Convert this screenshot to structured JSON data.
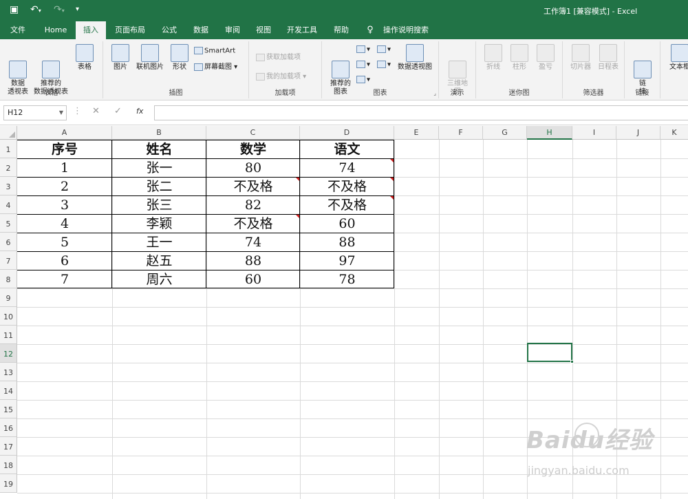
{
  "window": {
    "title": "工作簿1 [兼容模式] - Excel"
  },
  "tabs": [
    {
      "label": "文件"
    },
    {
      "label": "Home"
    },
    {
      "label": "插入",
      "active": true
    },
    {
      "label": "页面布局"
    },
    {
      "label": "公式"
    },
    {
      "label": "数据"
    },
    {
      "label": "审阅"
    },
    {
      "label": "视图"
    },
    {
      "label": "开发工具"
    },
    {
      "label": "帮助"
    },
    {
      "label": "操作说明搜索"
    }
  ],
  "ribbon": {
    "groups": {
      "tables": "表格",
      "illustrations": "插图",
      "addins": "加载项",
      "charts": "图表",
      "tours": "演示",
      "sparklines": "迷你图",
      "filters": "筛选器",
      "links": "链接"
    },
    "buttons": {
      "pivot_table": "数据\n透视表",
      "recommended_pivot": "推荐的\n数据透视表",
      "table": "表格",
      "pictures": "图片",
      "online_pictures": "联机图片",
      "shapes": "形状",
      "smartart": "SmartArt",
      "screenshot": "屏幕截图",
      "get_addins": "获取加载项",
      "my_addins": "我的加载项",
      "recommended_charts": "推荐的\n图表",
      "pivot_chart": "数据透视图",
      "map_3d": "三维地\n图",
      "spark_line": "折线",
      "spark_column": "柱形",
      "spark_winloss": "盈亏",
      "slicer": "切片器",
      "timeline": "日程表",
      "link": "链\n接",
      "textbox": "文本框"
    }
  },
  "formula_bar": {
    "name_box": "H12",
    "fx": "fx",
    "value": ""
  },
  "columns": [
    "A",
    "B",
    "C",
    "D",
    "E",
    "F",
    "G",
    "H",
    "I",
    "J",
    "K"
  ],
  "selected_column": "H",
  "rows": [
    "1",
    "2",
    "3",
    "4",
    "5",
    "6",
    "7",
    "8",
    "9",
    "10",
    "11",
    "12",
    "13",
    "14",
    "15",
    "16",
    "17",
    "18",
    "19"
  ],
  "selected_row": "12",
  "sheet": {
    "headers": [
      "序号",
      "姓名",
      "数学",
      "语文"
    ],
    "rows": [
      [
        "1",
        "张一",
        "80",
        "74"
      ],
      [
        "2",
        "张二",
        "不及格",
        "不及格"
      ],
      [
        "3",
        "张三",
        "82",
        "不及格"
      ],
      [
        "4",
        "李颖",
        "不及格",
        "60"
      ],
      [
        "5",
        "王一",
        "74",
        "88"
      ],
      [
        "6",
        "赵五",
        "88",
        "97"
      ],
      [
        "7",
        "周六",
        "60",
        "78"
      ]
    ],
    "comment_cells": [
      "D2",
      "C3",
      "D3",
      "D4",
      "C5"
    ]
  },
  "watermark": {
    "logo": "Baidu经验",
    "url": "jingyan.baidu.com"
  },
  "colors": {
    "accent": "#217346",
    "comment": "#d21f1f"
  }
}
